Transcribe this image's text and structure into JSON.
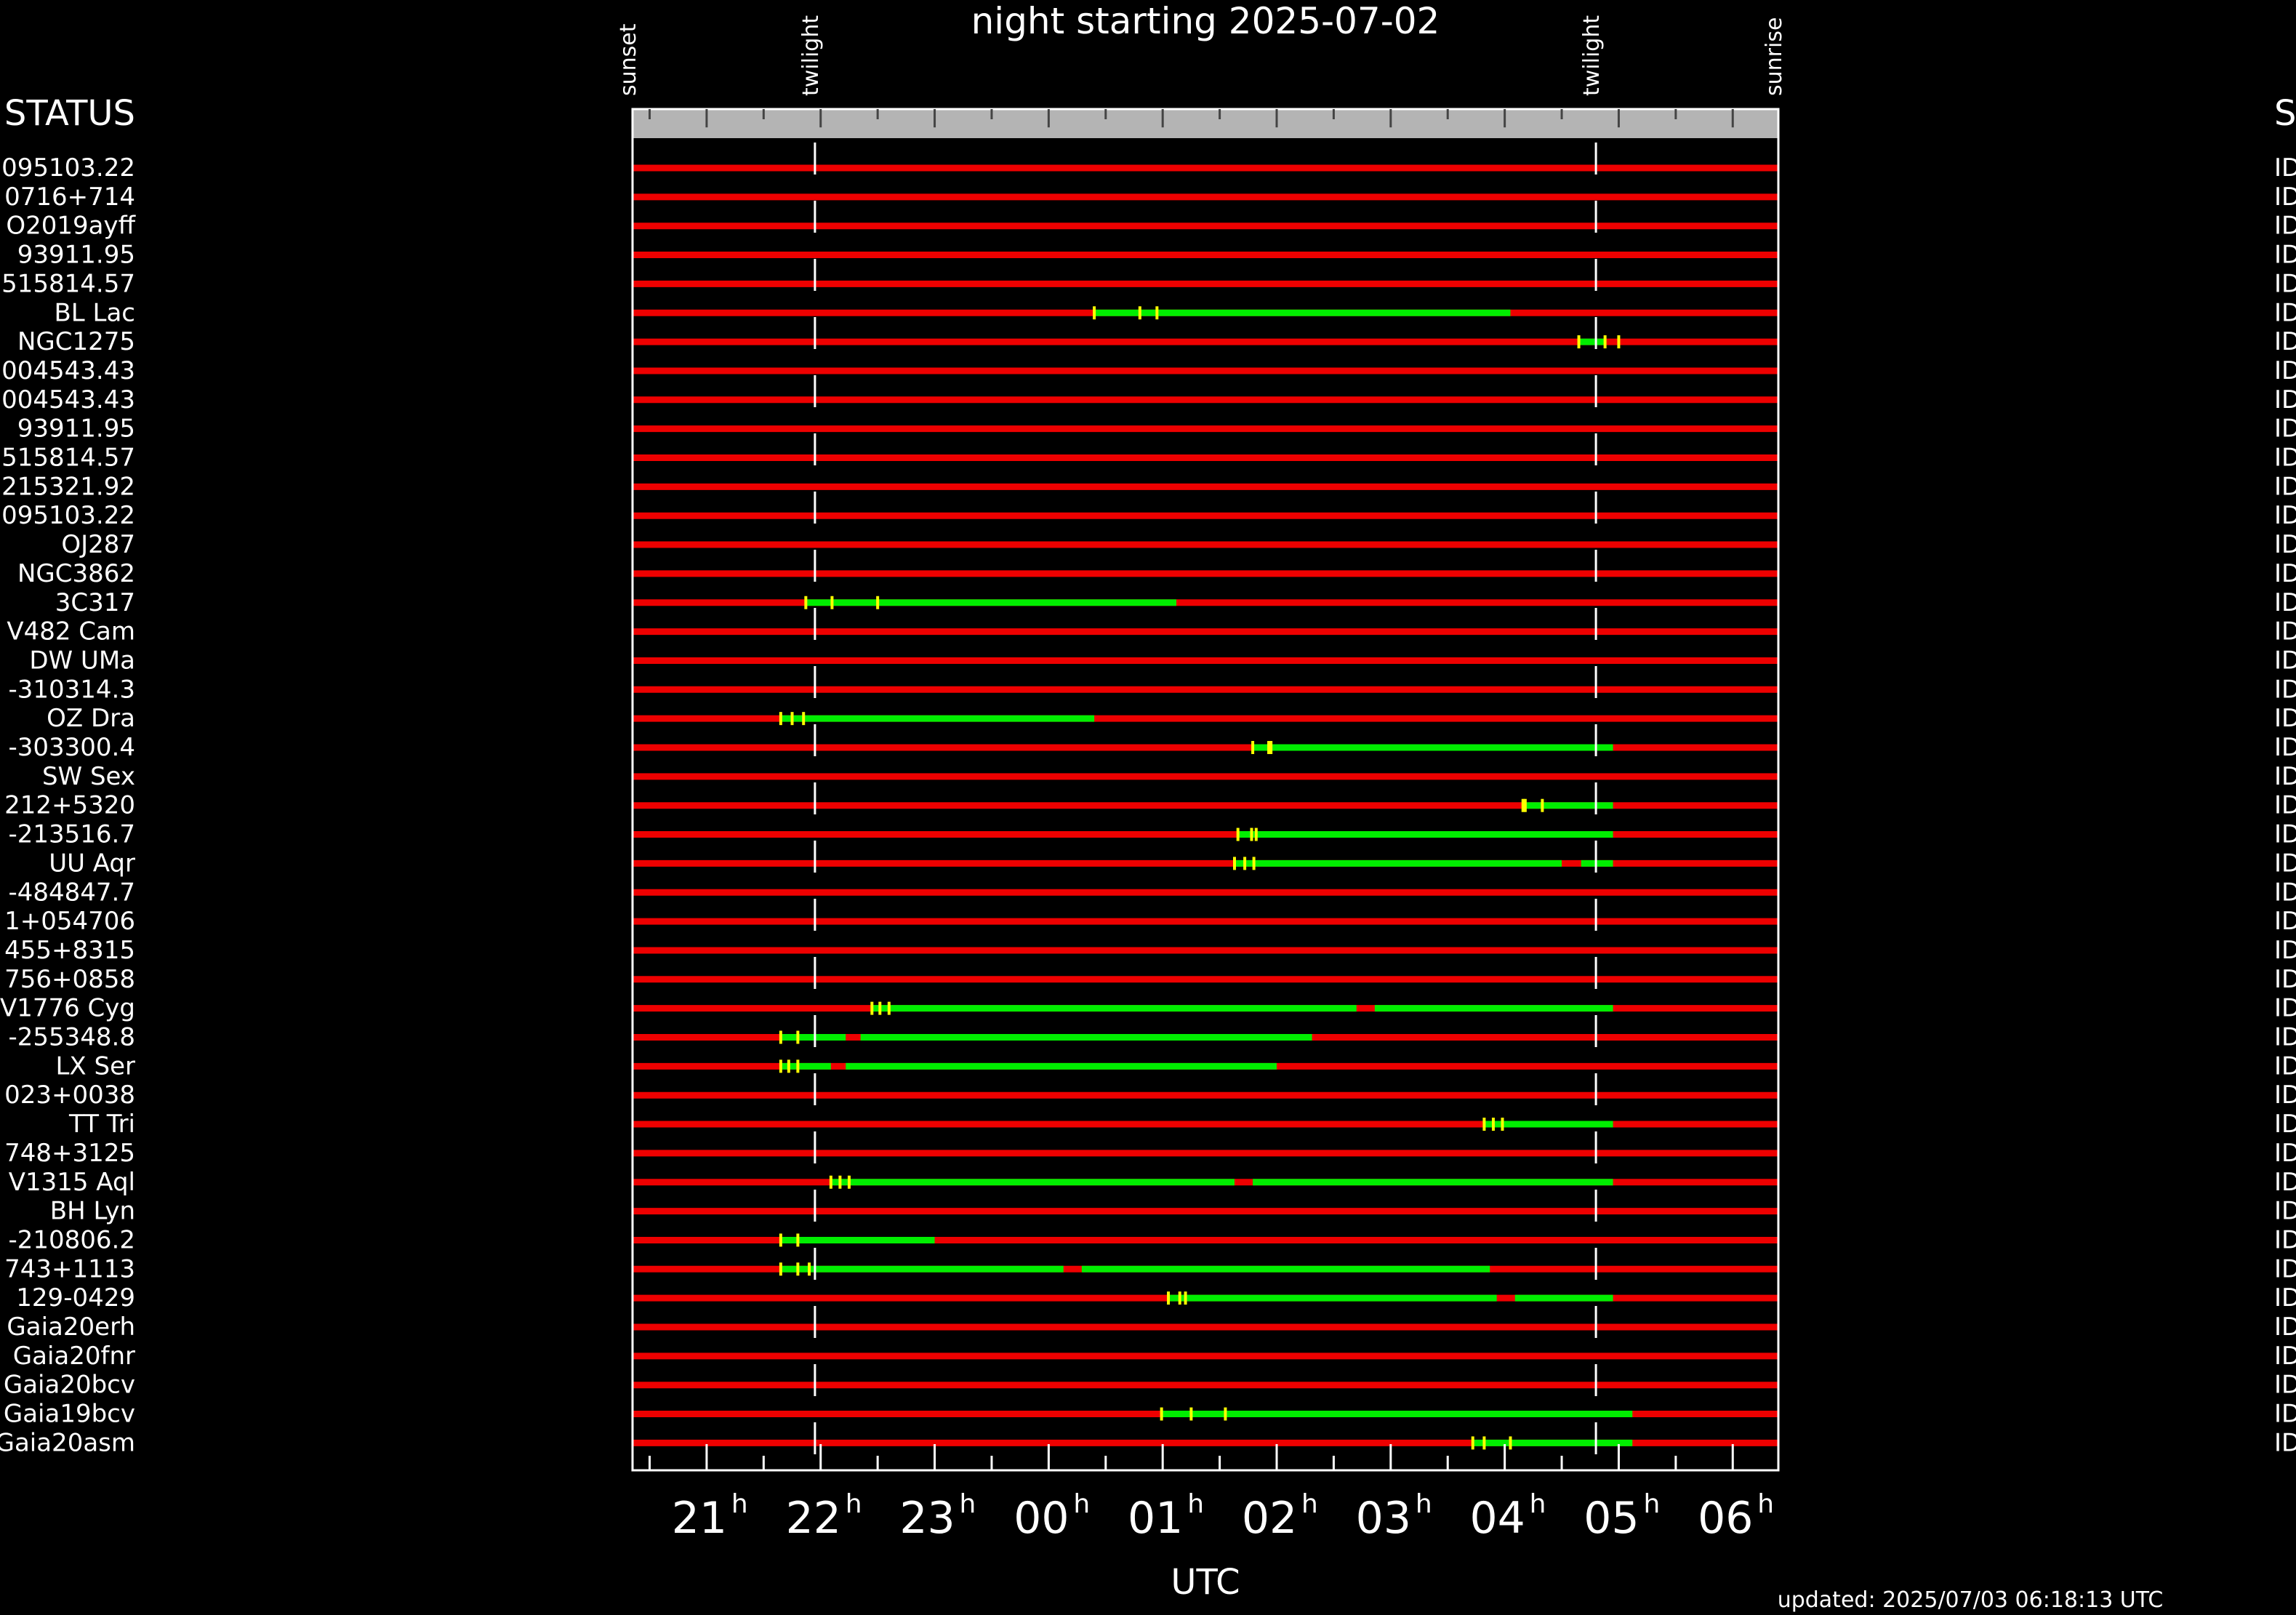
{
  "chart_data": {
    "type": "timeline",
    "title": "night starting 2025-07-02",
    "xlabel": "UTC",
    "updated": "updated: 2025/07/03 06:18:13 UTC",
    "left_header": "STATUS",
    "right_header": "S",
    "right_col_text": "ID",
    "x_unit": "hours UTC (values past 24 = next day)",
    "xlim": [
      20.35,
      30.4
    ],
    "tick_hours": [
      21,
      22,
      23,
      24,
      25,
      26,
      27,
      28,
      29,
      30
    ],
    "tick_labels": [
      "21",
      "22",
      "23",
      "00",
      "01",
      "02",
      "03",
      "04",
      "05",
      "06"
    ],
    "tick_sup": "h",
    "markers": [
      {
        "label": "sunset",
        "hour": 20.35
      },
      {
        "label": "twilight",
        "hour": 21.95
      },
      {
        "label": "twilight",
        "hour": 28.8
      },
      {
        "label": "sunrise",
        "hour": 30.4
      }
    ],
    "twilight_hours": [
      21.95,
      28.8
    ],
    "colors": {
      "unobservable": "#ee0000",
      "observable": "#00ee00",
      "tick_mark": "#ffff00",
      "marker": "#ffffff",
      "header_bar": "#b4b4b4"
    },
    "rows": [
      {
        "name": "095103.22",
        "segments": [],
        "ticks": []
      },
      {
        "name": "0716+714",
        "segments": [],
        "ticks": []
      },
      {
        "name": "O2019ayff",
        "segments": [],
        "ticks": []
      },
      {
        "name": "93911.95",
        "segments": [],
        "ticks": []
      },
      {
        "name": "515814.57",
        "segments": [],
        "ticks": []
      },
      {
        "name": "BL Lac",
        "segments": [
          [
            24.4,
            28.05
          ]
        ],
        "ticks": [
          24.4,
          24.8,
          24.95
        ]
      },
      {
        "name": "NGC1275",
        "segments": [
          [
            28.65,
            28.87
          ]
        ],
        "ticks": [
          28.65,
          28.88,
          29.0
        ]
      },
      {
        "name": "004543.43",
        "segments": [],
        "ticks": []
      },
      {
        "name": "004543.43",
        "segments": [],
        "ticks": []
      },
      {
        "name": "93911.95",
        "segments": [],
        "ticks": []
      },
      {
        "name": "515814.57",
        "segments": [],
        "ticks": []
      },
      {
        "name": "215321.92",
        "segments": [],
        "ticks": []
      },
      {
        "name": "095103.22",
        "segments": [],
        "ticks": []
      },
      {
        "name": "OJ287",
        "segments": [],
        "ticks": []
      },
      {
        "name": "NGC3862",
        "segments": [],
        "ticks": []
      },
      {
        "name": "3C317",
        "segments": [
          [
            21.87,
            25.12
          ]
        ],
        "ticks": [
          21.87,
          22.1,
          22.5
        ]
      },
      {
        "name": "V482 Cam",
        "segments": [],
        "ticks": []
      },
      {
        "name": "DW UMa",
        "segments": [],
        "ticks": []
      },
      {
        "name": "-310314.3",
        "segments": [],
        "ticks": []
      },
      {
        "name": "OZ Dra",
        "segments": [
          [
            21.65,
            24.4
          ]
        ],
        "ticks": [
          21.65,
          21.75,
          21.85
        ]
      },
      {
        "name": "-303300.4",
        "segments": [
          [
            25.79,
            28.95
          ]
        ],
        "ticks": [
          25.79,
          25.93,
          25.95
        ]
      },
      {
        "name": "SW Sex",
        "segments": [],
        "ticks": []
      },
      {
        "name": "212+5320",
        "segments": [
          [
            28.16,
            28.95
          ]
        ],
        "ticks": [
          28.16,
          28.18,
          28.33
        ]
      },
      {
        "name": "-213516.7",
        "segments": [
          [
            25.66,
            28.95
          ]
        ],
        "ticks": [
          25.66,
          25.78,
          25.82
        ]
      },
      {
        "name": "UU Aqr",
        "segments": [
          [
            25.63,
            28.5
          ],
          [
            28.67,
            28.95
          ]
        ],
        "ticks": [
          25.63,
          25.72,
          25.8
        ]
      },
      {
        "name": "-484847.7",
        "segments": [],
        "ticks": []
      },
      {
        "name": "1+054706",
        "segments": [],
        "ticks": []
      },
      {
        "name": "455+8315",
        "segments": [],
        "ticks": []
      },
      {
        "name": "756+0858",
        "segments": [],
        "ticks": []
      },
      {
        "name": "V1776 Cyg",
        "segments": [
          [
            22.45,
            26.7
          ],
          [
            26.86,
            28.95
          ]
        ],
        "ticks": [
          22.45,
          22.52,
          22.6
        ]
      },
      {
        "name": "-255348.8",
        "segments": [
          [
            21.65,
            22.22
          ],
          [
            22.35,
            26.31
          ]
        ],
        "ticks": [
          21.65,
          21.8
        ]
      },
      {
        "name": "LX Ser",
        "segments": [
          [
            21.65,
            22.09
          ],
          [
            22.22,
            26.0
          ]
        ],
        "ticks": [
          21.65,
          21.72,
          21.8
        ]
      },
      {
        "name": "023+0038",
        "segments": [],
        "ticks": []
      },
      {
        "name": "TT Tri",
        "segments": [
          [
            27.82,
            28.95
          ]
        ],
        "ticks": [
          27.82,
          27.9,
          27.98
        ]
      },
      {
        "name": "748+3125",
        "segments": [],
        "ticks": []
      },
      {
        "name": "V1315 Aql",
        "segments": [
          [
            22.09,
            25.63
          ],
          [
            25.79,
            28.95
          ]
        ],
        "ticks": [
          22.09,
          22.17,
          22.25
        ]
      },
      {
        "name": "BH Lyn",
        "segments": [],
        "ticks": []
      },
      {
        "name": "-210806.2",
        "segments": [
          [
            21.65,
            23.0
          ]
        ],
        "ticks": [
          21.65,
          21.8
        ]
      },
      {
        "name": "743+1113",
        "segments": [
          [
            21.65,
            24.13
          ],
          [
            24.29,
            27.87
          ]
        ],
        "ticks": [
          21.65,
          21.8,
          21.9
        ]
      },
      {
        "name": "129-0429",
        "segments": [
          [
            25.05,
            27.93
          ],
          [
            28.09,
            28.95
          ]
        ],
        "ticks": [
          25.05,
          25.15,
          25.2
        ]
      },
      {
        "name": "Gaia20erh",
        "segments": [],
        "ticks": []
      },
      {
        "name": "Gaia20fnr",
        "segments": [],
        "ticks": []
      },
      {
        "name": "Gaia20bcv",
        "segments": [],
        "ticks": []
      },
      {
        "name": "Gaia19bcv",
        "segments": [
          [
            24.99,
            29.12
          ]
        ],
        "ticks": [
          24.99,
          25.25,
          25.55
        ]
      },
      {
        "name": "Gaia20asm",
        "segments": [
          [
            27.72,
            29.12
          ]
        ],
        "ticks": [
          27.72,
          27.82,
          28.05
        ]
      }
    ]
  }
}
